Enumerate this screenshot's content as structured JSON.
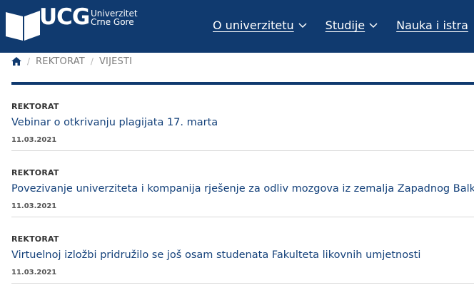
{
  "header": {
    "logo": {
      "abbr": "UCG",
      "name_line1": "Univerzitet",
      "name_line2": "Crne Gore"
    },
    "nav": [
      {
        "label": "O univerzitetu"
      },
      {
        "label": "Studije"
      },
      {
        "label": "Nauka i istra"
      }
    ]
  },
  "breadcrumb": {
    "home_icon": "home-icon",
    "items": [
      "REKTORAT",
      "VIJESTI"
    ]
  },
  "news": [
    {
      "category": "REKTORAT",
      "title": "Vebinar o otkrivanju plagijata 17. marta",
      "date": "11.03.2021"
    },
    {
      "category": "REKTORAT",
      "title": "Povezivanje univerziteta i kompanija rješenje za odliv mozgova iz zemalja Zapadnog Balkana",
      "date": "11.03.2021"
    },
    {
      "category": "REKTORAT",
      "title": "Virtuelnoj izložbi pridružilo se još osam studenata Fakulteta likovnih umjetnosti",
      "date": "11.03.2021"
    }
  ],
  "colors": {
    "brand": "#103a6f",
    "link": "#14417a"
  }
}
